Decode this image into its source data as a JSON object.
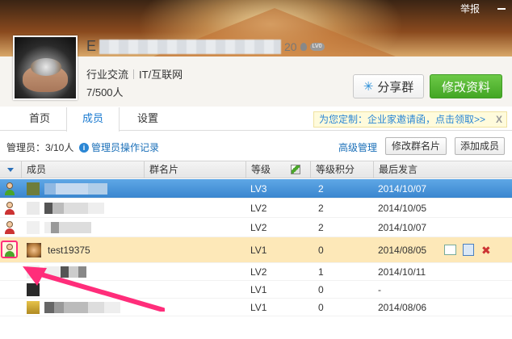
{
  "header": {
    "report_label": "举报",
    "group_name_initial": "E",
    "member_badge_number": "20",
    "level_badge": "LV0",
    "tags": [
      "行业交流",
      "IT/互联网"
    ],
    "member_count": "7/500人",
    "share_button": "分享群",
    "edit_button": "修改资料"
  },
  "tabs": [
    {
      "label": "首页",
      "active": false
    },
    {
      "label": "成员",
      "active": true
    },
    {
      "label": "设置",
      "active": false
    }
  ],
  "promo": {
    "text": "为您定制：企业家邀请函，点击领取>>",
    "close": "X"
  },
  "toolbar": {
    "admins_label": "管理员：3/10人",
    "admin_log_link": "管理员操作记录",
    "advanced_link": "高级管理",
    "edit_card_button": "修改群名片",
    "add_member_button": "添加成员"
  },
  "table": {
    "columns": [
      "成员",
      "群名片",
      "等级",
      "等级积分",
      "最后发言"
    ],
    "rows": [
      {
        "role": "owner",
        "name": "",
        "level": "LV3",
        "points": "2",
        "last": "2014/10/07",
        "state": "selected"
      },
      {
        "role": "admin",
        "name": "",
        "level": "LV2",
        "points": "2",
        "last": "2014/10/05",
        "state": ""
      },
      {
        "role": "admin",
        "name": "",
        "level": "LV2",
        "points": "2",
        "last": "2014/10/07",
        "state": ""
      },
      {
        "role": "admin",
        "name": "test19375",
        "level": "LV1",
        "points": "0",
        "last": "2014/08/05",
        "state": "hover"
      },
      {
        "role": "",
        "name": "",
        "level": "LV2",
        "points": "1",
        "last": "2014/10/11",
        "state": ""
      },
      {
        "role": "",
        "name": "",
        "level": "LV1",
        "points": "0",
        "last": "-",
        "state": ""
      },
      {
        "role": "",
        "name": "",
        "level": "LV1",
        "points": "0",
        "last": "2014/08/06",
        "state": ""
      }
    ]
  },
  "colors": {
    "accent_blue": "#1a7ad0",
    "green_button": "#43a624",
    "highlight": "#ff2d7a",
    "selected_row": "#3a86cf",
    "hover_row": "#fde8b8"
  }
}
